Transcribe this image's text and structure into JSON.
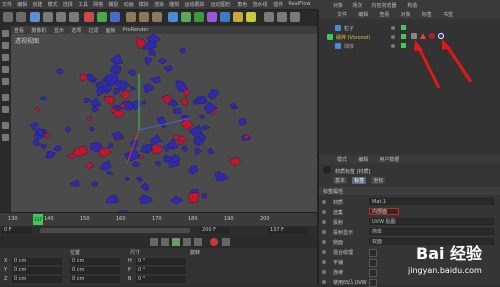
{
  "menubar": [
    "文件",
    "编辑",
    "创建",
    "模式",
    "选择",
    "工具",
    "网格",
    "捕捉",
    "动画",
    "模拟",
    "渲染",
    "雕刻",
    "运动跟踪",
    "运动图形",
    "角色",
    "流水线",
    "插件",
    "RealFlow",
    "脚本",
    "窗口",
    "帮助"
  ],
  "viewport": {
    "menu": [
      "查看",
      "摄像机",
      "显示",
      "选项",
      "过滤",
      "面板",
      "ProRender"
    ],
    "label": "透视视图"
  },
  "timeline": {
    "ticks": [
      "130",
      "140",
      "150",
      "160",
      "170",
      "180",
      "190",
      "200"
    ],
    "current_frame": "137",
    "frame_readout": "137 F",
    "start_field": "0 F",
    "end_field": "200 F"
  },
  "coords": {
    "headers": [
      "位置",
      "尺寸",
      "旋转"
    ],
    "rows": [
      {
        "axis": "X",
        "pos": "0 cm",
        "size": "0 cm",
        "rot_label": "H",
        "rot": "0 °"
      },
      {
        "axis": "Y",
        "pos": "0 cm",
        "size": "0 cm",
        "rot_label": "P",
        "rot": "0 °"
      },
      {
        "axis": "Z",
        "pos": "0 cm",
        "size": "0 cm",
        "rot_label": "B",
        "rot": "0 °"
      }
    ]
  },
  "right_tabs": [
    "对象",
    "场次",
    "内容浏览器",
    "构造"
  ],
  "object_manager": {
    "menu": [
      "文件",
      "编辑",
      "查看",
      "对象",
      "标签",
      "书签"
    ],
    "objects": [
      {
        "name": "粒子"
      },
      {
        "name": "破碎 (Voronoi)"
      },
      {
        "name": "球体"
      }
    ]
  },
  "attributes": {
    "menu": [
      "模式",
      "编辑",
      "用户数据"
    ],
    "title": "材质标签 [材质]",
    "tabs": [
      "基本",
      "标签",
      "坐标"
    ],
    "section": "标签属性",
    "fields": [
      {
        "label": "材质",
        "value": "Mat.1"
      },
      {
        "label": "选集",
        "value": "内部面"
      },
      {
        "label": "投射",
        "value": "UVW 贴图"
      },
      {
        "label": "投射显示",
        "value": "简单"
      },
      {
        "label": "侧面",
        "value": "双面"
      },
      {
        "label": "混合纹理",
        "value": ""
      },
      {
        "label": "平铺",
        "value": ""
      },
      {
        "label": "连续",
        "value": ""
      },
      {
        "label": "使用凹凸 UVW",
        "value": ""
      }
    ]
  },
  "watermark": {
    "main": "Bai 经验",
    "sub": "jingyan.baidu.com"
  },
  "colors": {
    "fragment_blue": "#2f2aa8",
    "fragment_red": "#c0182a",
    "annotation_red": "#e01818",
    "selection_green": "#3cc95a"
  }
}
